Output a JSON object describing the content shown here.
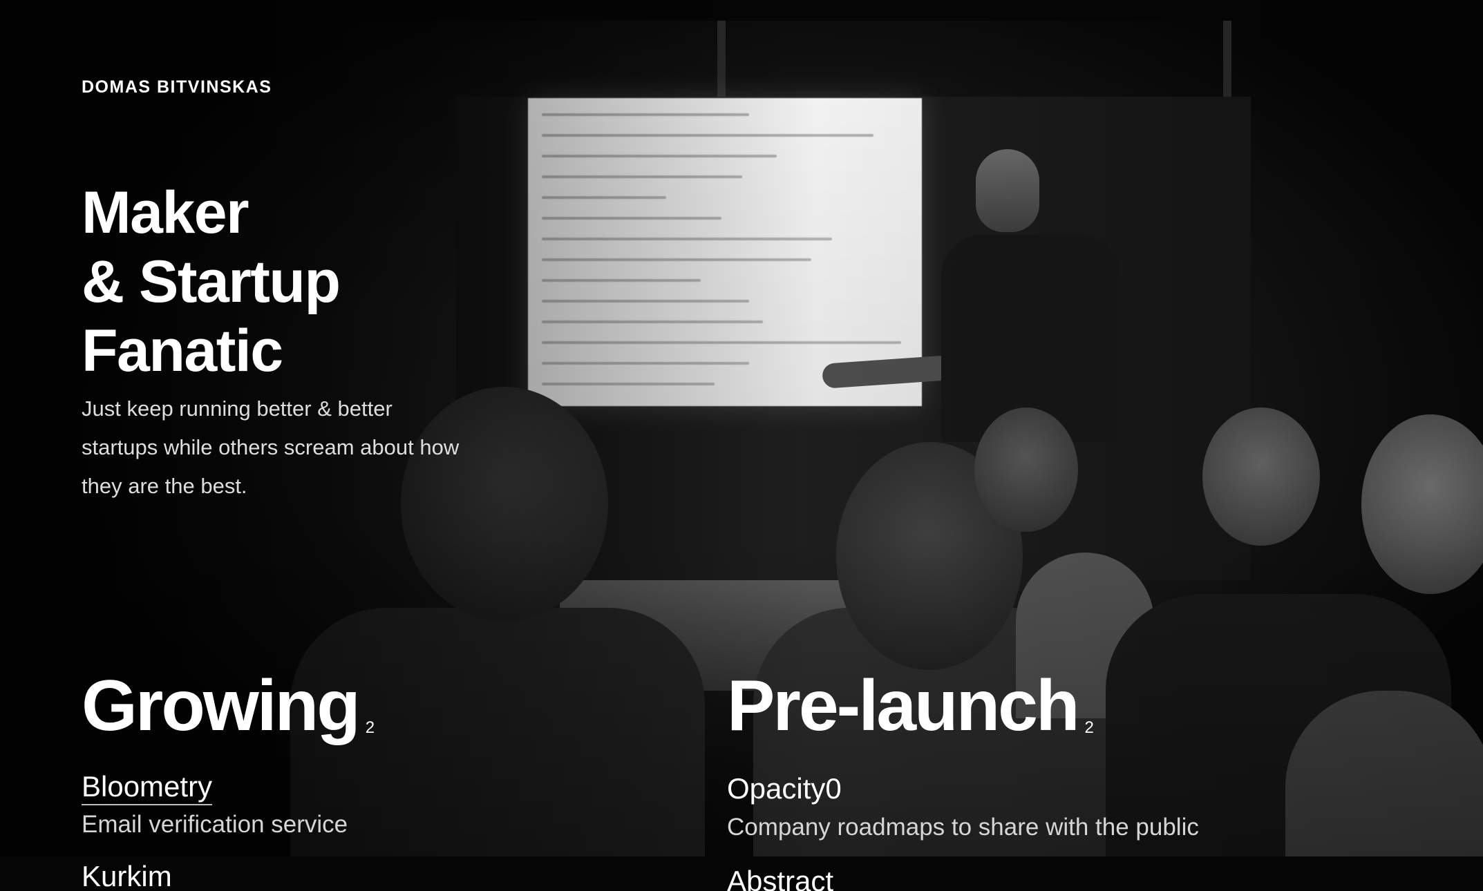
{
  "header": {
    "brand": "DOMAS BITVINSKAS"
  },
  "hero": {
    "title_lines": [
      "Maker",
      "& Startup",
      "Fanatic"
    ],
    "subtitle": "Just keep running better & better startups while others scream about how they are the best."
  },
  "sections": [
    {
      "title": "Growing",
      "count": "2",
      "projects": [
        {
          "name": "Bloometry",
          "description": "Email verification service",
          "linked": true
        },
        {
          "name": "Kurkim",
          "description": "",
          "linked": true
        }
      ]
    },
    {
      "title": "Pre-launch",
      "count": "2",
      "projects": [
        {
          "name": "Opacity0",
          "description": "Company roadmaps to share with the public",
          "linked": false
        },
        {
          "name": "Abstract",
          "description": "",
          "linked": false
        }
      ]
    }
  ],
  "background": {
    "description_icon": "presentation-photo",
    "tone": "#1a1a1a"
  }
}
